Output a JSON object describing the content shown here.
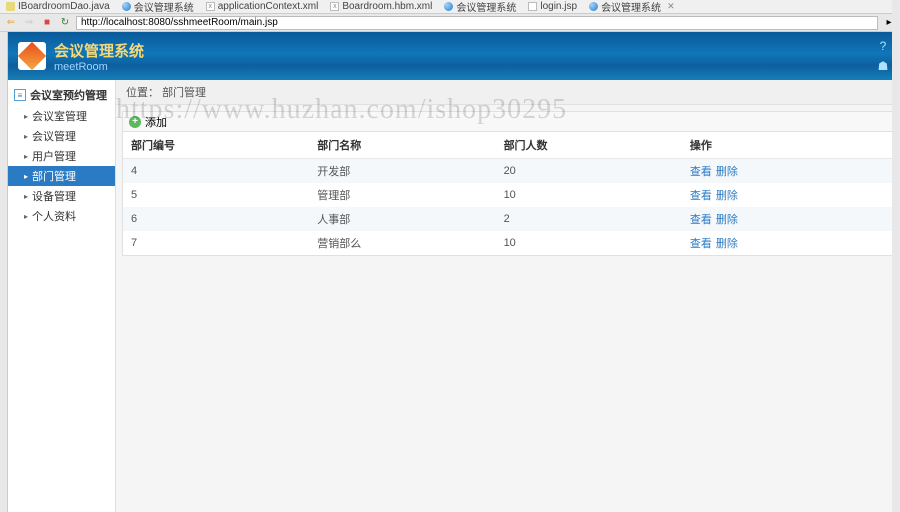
{
  "ide_tabs": [
    {
      "label": "IBoardroomDao.java",
      "ico": "j"
    },
    {
      "label": "会议管理系统",
      "ico": "globe"
    },
    {
      "label": "applicationContext.xml",
      "ico": "x"
    },
    {
      "label": "Boardroom.hbm.xml",
      "ico": "x"
    },
    {
      "label": "会议管理系统",
      "ico": "globe"
    },
    {
      "label": "login.jsp",
      "ico": "d"
    },
    {
      "label": "会议管理系统",
      "ico": "globe",
      "close": true
    }
  ],
  "url": "http://localhost:8080/sshmeetRoom/main.jsp",
  "app_title": "会议管理系统",
  "app_sub": "meetRoom",
  "breadcrumb": {
    "label": "位置：",
    "value": "部门管理"
  },
  "sidebar": {
    "head": "会议室预约管理",
    "items": [
      {
        "label": "会议室管理"
      },
      {
        "label": "会议管理"
      },
      {
        "label": "用户管理"
      },
      {
        "label": "部门管理",
        "active": true
      },
      {
        "label": "设备管理"
      },
      {
        "label": "个人资料"
      }
    ]
  },
  "add_btn": "添加",
  "table": {
    "headers": [
      "部门编号",
      "部门名称",
      "部门人数",
      "操作"
    ],
    "rows": [
      {
        "id": "4",
        "name": "开发部",
        "count": "20"
      },
      {
        "id": "5",
        "name": "管理部",
        "count": "10"
      },
      {
        "id": "6",
        "name": "人事部",
        "count": "2"
      },
      {
        "id": "7",
        "name": "营销部么",
        "count": "10"
      }
    ],
    "act_edit": "查看",
    "act_del": "删除"
  },
  "watermark": "https://www.huzhan.com/ishop30295"
}
